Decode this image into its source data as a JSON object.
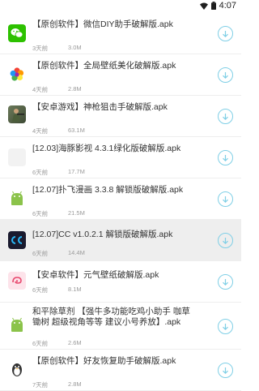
{
  "status_bar": {
    "time": "4:07"
  },
  "items": [
    {
      "title": "【原创软件】微信DIY助手破解版.apk",
      "date": "3天前",
      "size": "3.0M",
      "icon": "wechat-icon"
    },
    {
      "title": "【原创软件】全局壁纸美化破解版.apk",
      "date": "4天前",
      "size": "2.8M",
      "icon": "color-flower-icon"
    },
    {
      "title": "【安卓游戏】神枪狙击手破解版.apk",
      "date": "4天前",
      "size": "63.1M",
      "icon": "sniper-game-icon"
    },
    {
      "title": "[12.03]海豚影视 4.3.1绿化版破解版.apk",
      "date": "6天前",
      "size": "17.7M",
      "icon": "blank-icon"
    },
    {
      "title": "[12.07]扑飞漫画 3.3.8 解锁版破解版.apk",
      "date": "6天前",
      "size": "21.5M",
      "icon": "android-icon"
    },
    {
      "title": "[12.07]CC v1.0.2.1 解锁版破解版.apk",
      "date": "6天前",
      "size": "14.4M",
      "icon": "cc-app-icon"
    },
    {
      "title": "【安卓软件】元气壁纸破解版.apk",
      "date": "6天前",
      "size": "8.1M",
      "icon": "wallpaper-app-icon"
    },
    {
      "title": "和平除草剂 【强牛多功能吃鸡小助手 咖草 锄树 超级视角等等 建议小号养放】.apk",
      "date": "6天前",
      "size": "2.6M",
      "icon": "android-icon"
    },
    {
      "title": "【原创软件】好友恢复助手破解版.apk",
      "date": "7天前",
      "size": "2.8M",
      "icon": "qq-penguin-icon"
    }
  ],
  "colors": {
    "accent": "#7fcfe6",
    "android": "#8bc34a",
    "wechat": "#2dc100",
    "cc": "#1a1a2e"
  }
}
